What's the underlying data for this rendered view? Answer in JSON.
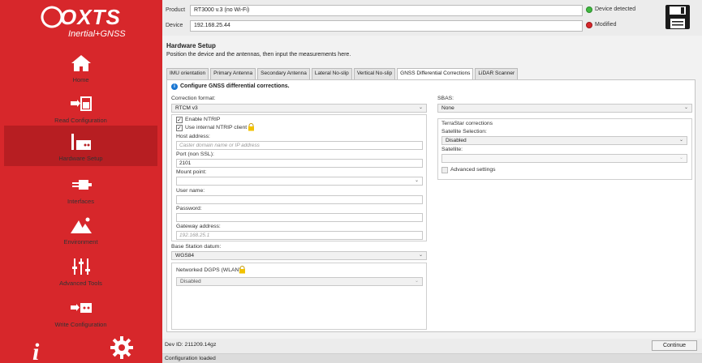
{
  "brand": {
    "name": "OXTS",
    "tagline": "Inertial+GNSS"
  },
  "sidebar": {
    "items": [
      {
        "label": "Home",
        "icon": "home-icon"
      },
      {
        "label": "Read Configuration",
        "icon": "read-config-icon"
      },
      {
        "label": "Hardware Setup",
        "icon": "hardware-setup-icon",
        "active": true
      },
      {
        "label": "Interfaces",
        "icon": "interfaces-icon"
      },
      {
        "label": "Environment",
        "icon": "environment-icon"
      },
      {
        "label": "Advanced Tools",
        "icon": "advanced-tools-icon"
      },
      {
        "label": "Write Configuration",
        "icon": "write-config-icon"
      }
    ],
    "bottom": {
      "info": "i",
      "settings_icon": "gear-icon"
    }
  },
  "header": {
    "product_label": "Product",
    "product_value": "RT3000 v.3 (no Wi-Fi)",
    "device_label": "Device",
    "device_value": "192.168.25.44",
    "status_detected": "Device detected",
    "status_modified": "Modified",
    "colors": {
      "detected": "#3fb83f",
      "modified": "#d7272b"
    }
  },
  "main": {
    "title": "Hardware Setup",
    "subtitle": "Position the device and the antennas, then input the measurements here.",
    "tabs": [
      "IMU orientation",
      "Primary Antenna",
      "Secondary Antenna",
      "Lateral No-slip",
      "Vertical No-slip",
      "GNSS Differential Corrections",
      "LiDAR Scanner"
    ],
    "active_tab": "GNSS Differential Corrections",
    "panel_heading": "Configure GNSS differential corrections.",
    "left": {
      "correction_format_label": "Correction format:",
      "correction_format_value": "RTCM v3",
      "enable_ntrip_label": "Enable NTRIP",
      "use_internal_ntrip_label": "Use internal NTRIP client",
      "host_address_label": "Host address:",
      "host_address_placeholder": "Caster domain name or IP address",
      "port_label": "Port (non SSL):",
      "port_value": "2101",
      "mount_point_label": "Mount point:",
      "mount_point_value": "",
      "user_name_label": "User name:",
      "user_name_value": "",
      "password_label": "Password:",
      "password_value": "",
      "gateway_label": "Gateway address:",
      "gateway_placeholder": "192.168.25.1",
      "base_station_label": "Base Station datum:",
      "base_station_value": "WGS84",
      "networked_dgps_label": "Networked DGPS (WLAN)",
      "networked_dgps_value": "Disabled"
    },
    "right": {
      "sbas_label": "SBAS:",
      "sbas_value": "None",
      "terrastar_label": "TerraStar corrections",
      "satellite_selection_label": "Satellite Selection:",
      "satellite_selection_value": "Disabled",
      "satellite_label": "Satellite:",
      "satellite_value": "",
      "advanced_settings_label": "Advanced settings"
    }
  },
  "footer": {
    "dev_id": "Dev ID: 211209.14gz",
    "continue_label": "Continue",
    "status": "Configuration loaded"
  }
}
